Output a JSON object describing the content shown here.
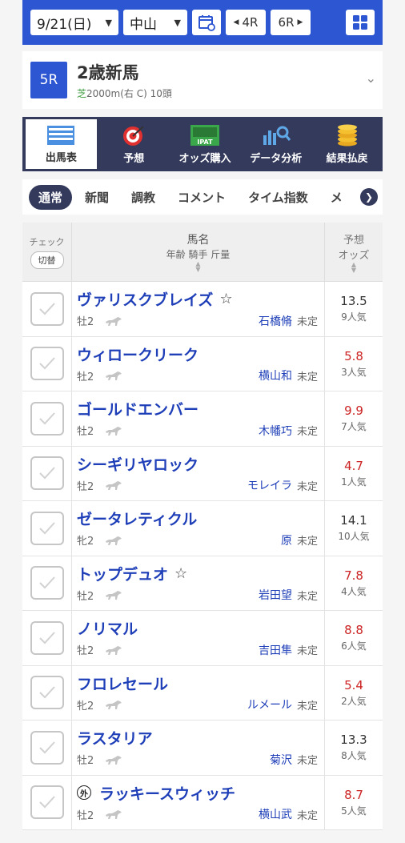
{
  "topbar": {
    "date": "9/21(日)",
    "venue": "中山",
    "prev_race": "4R",
    "next_race": "6R",
    "accent": "#2d56d3"
  },
  "race": {
    "number": "5R",
    "title": "2歳新馬",
    "surface": "芝",
    "course": "2000m(右 C) 10頭"
  },
  "menu": [
    {
      "label": "出馬表",
      "icon": "entry-table-icon",
      "active": true
    },
    {
      "label": "予想",
      "icon": "target-icon",
      "active": false
    },
    {
      "label": "オッズ購入",
      "icon": "ipat-icon",
      "active": false
    },
    {
      "label": "データ分析",
      "icon": "chart-search-icon",
      "active": false
    },
    {
      "label": "結果払戻",
      "icon": "coins-icon",
      "active": false
    }
  ],
  "tabs": [
    "通常",
    "新聞",
    "調教",
    "コメント",
    "タイム指数",
    "メ"
  ],
  "table": {
    "header": {
      "check": "チェック",
      "toggle": "切替",
      "name": "馬名",
      "name_sub": "年齢 騎手 斤量",
      "odds_l1": "予想",
      "odds_l2": "オッズ"
    },
    "rows": [
      {
        "name": "ヴァリスクブレイズ",
        "star": "☆",
        "foreign": "",
        "sexage": "牡2",
        "jockey": "石橋脩",
        "weight": "未定",
        "odds": "13.5",
        "pop": "9人気",
        "hot": false
      },
      {
        "name": "ウィロークリーク",
        "star": "",
        "foreign": "",
        "sexage": "牡2",
        "jockey": "横山和",
        "weight": "未定",
        "odds": "5.8",
        "pop": "3人気",
        "hot": true
      },
      {
        "name": "ゴールドエンバー",
        "star": "",
        "foreign": "",
        "sexage": "牡2",
        "jockey": "木幡巧",
        "weight": "未定",
        "odds": "9.9",
        "pop": "7人気",
        "hot": true
      },
      {
        "name": "シーギリヤロック",
        "star": "",
        "foreign": "",
        "sexage": "牡2",
        "jockey": "モレイラ",
        "weight": "未定",
        "odds": "4.7",
        "pop": "1人気",
        "hot": true
      },
      {
        "name": "ゼータレティクル",
        "star": "",
        "foreign": "",
        "sexage": "牝2",
        "jockey": "原",
        "weight": "未定",
        "odds": "14.1",
        "pop": "10人気",
        "hot": false
      },
      {
        "name": "トップデュオ",
        "star": "☆",
        "foreign": "",
        "sexage": "牡2",
        "jockey": "岩田望",
        "weight": "未定",
        "odds": "7.8",
        "pop": "4人気",
        "hot": true
      },
      {
        "name": "ノリマル",
        "star": "",
        "foreign": "",
        "sexage": "牡2",
        "jockey": "吉田隼",
        "weight": "未定",
        "odds": "8.8",
        "pop": "6人気",
        "hot": true
      },
      {
        "name": "フロレセール",
        "star": "",
        "foreign": "",
        "sexage": "牝2",
        "jockey": "ルメール",
        "weight": "未定",
        "odds": "5.4",
        "pop": "2人気",
        "hot": true
      },
      {
        "name": "ラスタリア",
        "star": "",
        "foreign": "",
        "sexage": "牡2",
        "jockey": "菊沢",
        "weight": "未定",
        "odds": "13.3",
        "pop": "8人気",
        "hot": false
      },
      {
        "name": "ラッキースウィッチ",
        "star": "",
        "foreign": "外",
        "sexage": "牡2",
        "jockey": "横山武",
        "weight": "未定",
        "odds": "8.7",
        "pop": "5人気",
        "hot": true
      }
    ]
  }
}
